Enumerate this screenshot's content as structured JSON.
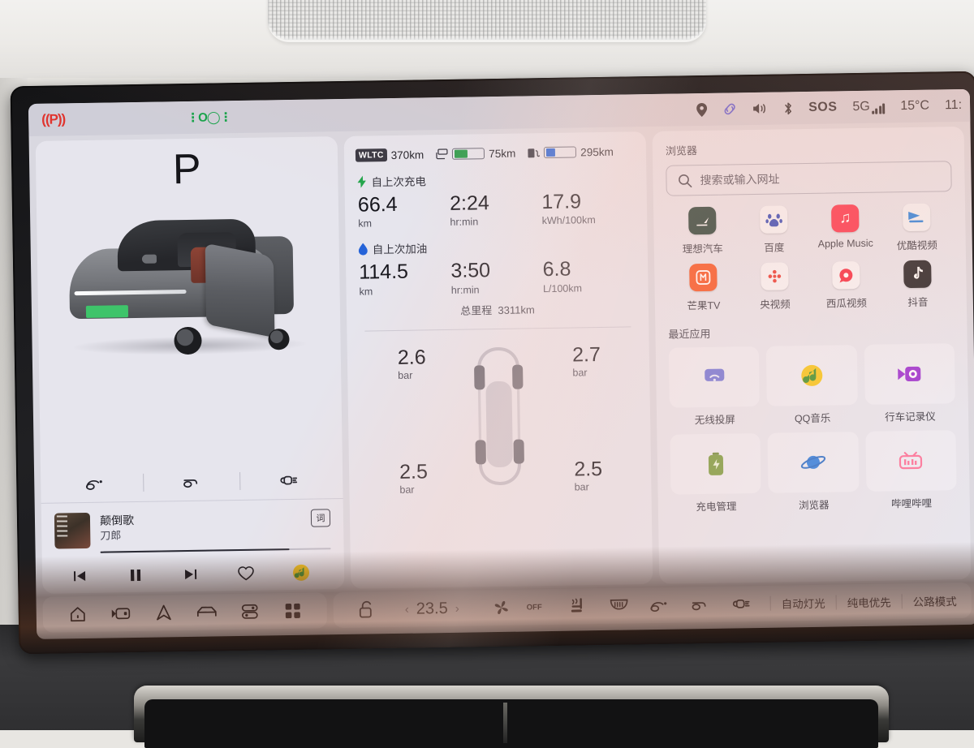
{
  "statusbar": {
    "park_brake": "((P))",
    "headlight_indicator": "headlight-on",
    "icons": [
      "location-pin-icon",
      "link-icon",
      "volume-icon",
      "bluetooth-icon"
    ],
    "sos_label": "SOS",
    "network": "5G",
    "temperature": "15°C",
    "clock": "11:"
  },
  "left_panel": {
    "gear": "P",
    "vehicle_image": "li-auto-suv-grey-door-open",
    "actions": [
      {
        "name": "trunk-release-icon",
        "label": "trunk"
      },
      {
        "name": "hood-release-icon",
        "label": "hood"
      },
      {
        "name": "charge-port-icon",
        "label": "charge-port"
      }
    ],
    "media": {
      "song_title": "颠倒歌",
      "artist": "刀郎",
      "lyrics_button": "词",
      "progress_percent": 82,
      "controls": [
        "previous-track",
        "pause",
        "next-track",
        "favorite",
        "qq-music-app"
      ]
    }
  },
  "center_panel": {
    "range": {
      "wltc_tag": "WLTC",
      "wltc_range": "370km",
      "battery_range": "75km",
      "battery_percent": 45,
      "battery_color": "#2f9e4f",
      "fuel_range": "295km",
      "fuel_percent": 32,
      "fuel_color": "#2563d8"
    },
    "since_charge": {
      "title": "自上次充电",
      "icon": "bolt-icon",
      "icon_color": "#22a54b",
      "metrics": [
        {
          "value": "66.4",
          "unit": "km"
        },
        {
          "value": "2:24",
          "unit": "hr:min"
        },
        {
          "value": "17.9",
          "unit": "kWh/100km"
        }
      ]
    },
    "since_refuel": {
      "title": "自上次加油",
      "icon": "droplet-icon",
      "icon_color": "#2563d8",
      "metrics": [
        {
          "value": "114.5",
          "unit": "km"
        },
        {
          "value": "3:50",
          "unit": "hr:min"
        },
        {
          "value": "6.8",
          "unit": "L/100km"
        }
      ]
    },
    "odometer": {
      "label": "总里程",
      "value": "3311km"
    },
    "tire_pressure": {
      "unit": "bar",
      "front_left": "2.6",
      "front_right": "2.7",
      "rear_left": "2.5",
      "rear_right": "2.5"
    }
  },
  "right_panel": {
    "browser_title": "浏览器",
    "search_placeholder": "搜索或输入网址",
    "apps": [
      {
        "name": "理想汽车",
        "icon": "li-auto-icon",
        "bg": "#1d3b33",
        "glyph": "◤"
      },
      {
        "name": "百度",
        "icon": "baidu-icon",
        "bg": "#f5f6fa",
        "glyph": "🐾"
      },
      {
        "name": "Apple Music",
        "icon": "apple-music-icon",
        "bg": "#fa2d48",
        "glyph": "♫"
      },
      {
        "name": "优酷视频",
        "icon": "youku-icon",
        "bg": "#f2f3f7",
        "glyph": "➤"
      },
      {
        "name": "芒果TV",
        "icon": "mango-tv-icon",
        "bg": "#f4511e",
        "glyph": "M"
      },
      {
        "name": "央视频",
        "icon": "cctv-video-icon",
        "bg": "#f6f6fa",
        "glyph": "❖"
      },
      {
        "name": "西瓜视频",
        "icon": "xigua-video-icon",
        "bg": "#f6f6fa",
        "glyph": "●"
      },
      {
        "name": "抖音",
        "icon": "douyin-icon",
        "bg": "#1c1c20",
        "glyph": "♪"
      }
    ],
    "recent_title": "最近应用",
    "recent_apps": [
      {
        "name": "无线投屏",
        "icon": "wireless-cast-icon"
      },
      {
        "name": "QQ音乐",
        "icon": "qq-music-icon"
      },
      {
        "name": "行车记录仪",
        "icon": "dashcam-icon"
      },
      {
        "name": "充电管理",
        "icon": "charging-manager-icon"
      },
      {
        "name": "浏览器",
        "icon": "browser-icon"
      },
      {
        "name": "哔哩哔哩",
        "icon": "bilibili-icon"
      }
    ]
  },
  "bottom_bar": {
    "nav_icons": [
      "home-icon",
      "dashcam-icon",
      "navigation-icon",
      "vehicle-icon",
      "controls-icon",
      "apps-grid-icon"
    ],
    "lock_icon": "unlock-icon",
    "temp_decrease": "‹",
    "temp_value": "23.5",
    "temp_increase": "›",
    "fan_icon": "fan-icon",
    "fan_state": "OFF",
    "seat_icon": "seat-heat-icon",
    "defrost_icon": "rear-defrost-icon",
    "trunk_icon": "trunk-release-icon",
    "hood_icon": "hood-release-icon",
    "charge_icon": "charge-port-icon",
    "modes": [
      "自动灯光",
      "纯电优先",
      "公路模式"
    ]
  }
}
